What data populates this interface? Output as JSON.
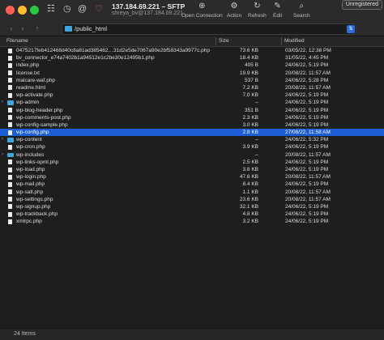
{
  "window": {
    "title": "137.184.69.221 – SFTP",
    "subtitle": "shreya_bv@137.184.69.221",
    "unregistered_label": "Unregistered"
  },
  "toolbar": {
    "open_connection": "Open Connection",
    "action": "Action",
    "refresh": "Refresh",
    "edit": "Edit",
    "search": "Search"
  },
  "path": {
    "value": "/public_html"
  },
  "columns": {
    "filename": "Filename",
    "size": "Size",
    "modified": "Modified"
  },
  "files": [
    {
      "name": "0475217feb412468d40c8a81ad385462…31d2e5de7067a90e2bf58343a9977c.php",
      "size": "73.6 KB",
      "modified": "03/05/22, 12:38 PM",
      "type": "file"
    },
    {
      "name": "bv_connector_e74a7402b1a94512e1c2be30e12495b1.php",
      "size": "18.4 KB",
      "modified": "31/05/22, 4:45 PM",
      "type": "file"
    },
    {
      "name": "index.php",
      "size": "405 B",
      "modified": "24/06/22, 5:19 PM",
      "type": "file"
    },
    {
      "name": "license.txt",
      "size": "19.9 KB",
      "modified": "20/08/22, 11:57 AM",
      "type": "file"
    },
    {
      "name": "malcare-waf.php",
      "size": "537 B",
      "modified": "24/06/22, 5:28 PM",
      "type": "file"
    },
    {
      "name": "readme.html",
      "size": "7.2 KB",
      "modified": "20/08/22, 11:57 AM",
      "type": "file"
    },
    {
      "name": "wp-activate.php",
      "size": "7.0 KB",
      "modified": "24/06/22, 5:19 PM",
      "type": "file"
    },
    {
      "name": "wp-admin",
      "size": "--",
      "modified": "24/06/22, 5:19 PM",
      "type": "folder"
    },
    {
      "name": "wp-blog-header.php",
      "size": "351 B",
      "modified": "24/06/22, 5:19 PM",
      "type": "file"
    },
    {
      "name": "wp-comments-post.php",
      "size": "2.3 KB",
      "modified": "24/06/22, 5:19 PM",
      "type": "file"
    },
    {
      "name": "wp-config-sample.php",
      "size": "3.0 KB",
      "modified": "24/06/22, 5:19 PM",
      "type": "file"
    },
    {
      "name": "wp-config.php",
      "size": "2.8 KB",
      "modified": "27/08/22, 11:58 AM",
      "type": "file",
      "selected": true
    },
    {
      "name": "wp-content",
      "size": "--",
      "modified": "24/06/22, 5:32 PM",
      "type": "folder"
    },
    {
      "name": "wp-cron.php",
      "size": "3.9 KB",
      "modified": "24/06/22, 5:19 PM",
      "type": "file"
    },
    {
      "name": "wp-includes",
      "size": "--",
      "modified": "20/08/22, 11:57 AM",
      "type": "folder"
    },
    {
      "name": "wp-links-opml.php",
      "size": "2.5 KB",
      "modified": "24/06/22, 5:19 PM",
      "type": "file"
    },
    {
      "name": "wp-load.php",
      "size": "3.6 KB",
      "modified": "24/06/22, 5:19 PM",
      "type": "file"
    },
    {
      "name": "wp-login.php",
      "size": "47.6 KB",
      "modified": "20/08/22, 11:57 AM",
      "type": "file"
    },
    {
      "name": "wp-mail.php",
      "size": "8.4 KB",
      "modified": "24/06/22, 5:19 PM",
      "type": "file"
    },
    {
      "name": "wp-salt.php",
      "size": "1.1 KB",
      "modified": "20/08/22, 11:57 AM",
      "type": "file"
    },
    {
      "name": "wp-settings.php",
      "size": "23.6 KB",
      "modified": "20/08/22, 11:57 AM",
      "type": "file"
    },
    {
      "name": "wp-signup.php",
      "size": "32.1 KB",
      "modified": "24/06/22, 5:19 PM",
      "type": "file"
    },
    {
      "name": "wp-trackback.php",
      "size": "4.8 KB",
      "modified": "24/06/22, 5:19 PM",
      "type": "file"
    },
    {
      "name": "xmlrpc.php",
      "size": "3.2 KB",
      "modified": "24/06/22, 5:19 PM",
      "type": "file"
    }
  ],
  "status": {
    "item_count": "24 Items"
  },
  "colors": {
    "selection": "#1c5fd4",
    "folder": "#3fa6e0",
    "close": "#ff5f57",
    "minimize": "#febc2e",
    "maximize": "#28c840"
  }
}
